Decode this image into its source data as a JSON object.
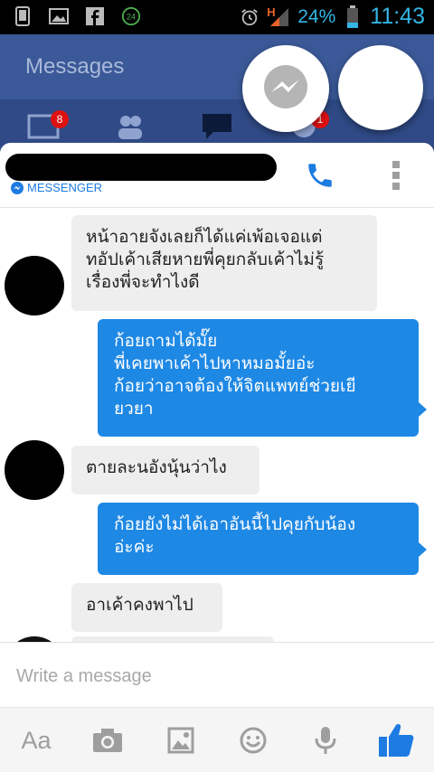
{
  "status_bar": {
    "network_type": "H",
    "battery_percent": "24%",
    "time": "11:43",
    "notification_badge": "24"
  },
  "app": {
    "title": "Messages",
    "tab_badges": [
      "8",
      "1"
    ]
  },
  "conversation": {
    "source_label": "MESSENGER",
    "messages": [
      {
        "direction": "incoming",
        "lines": [
          "หน้าอายจังเลยก็ได้แค่เพ้อเจอแต่",
          "ทอัปเค้าเสียหายพี่คุยกลับเค้าไม่รู้",
          "เรื่องพี่จะทำไงดี"
        ]
      },
      {
        "direction": "outgoing",
        "lines": [
          "ก้อยถามได้มั๊ย",
          "พี่เคยพาเค้าไปหาหมอมั้ยอ่ะ",
          "ก้อยว่าอาจต้องให้จิตแพทย์ช่วยเยี",
          "ยวยา"
        ]
      },
      {
        "direction": "incoming",
        "lines": [
          "ตายละนอังนุ้นว่าไง"
        ]
      },
      {
        "direction": "outgoing",
        "lines": [
          "ก้อยยังไม่ได้เอาอันนี้ไปคุยกับน้อง",
          "อ่ะค่ะ"
        ]
      },
      {
        "direction": "incoming",
        "lines": [
          "อาเค้าคงพาไป"
        ]
      }
    ]
  },
  "composer": {
    "placeholder": "Write a message"
  },
  "toolbar": {
    "text_tool_label": "Aa",
    "items": [
      "text-format",
      "camera",
      "gallery",
      "emoji",
      "microphone",
      "like"
    ]
  },
  "colors": {
    "accent": "#1e88e5",
    "header_bg": "#3b5998",
    "incoming_bubble": "#eeeeee",
    "status_text": "#33b5e5"
  }
}
